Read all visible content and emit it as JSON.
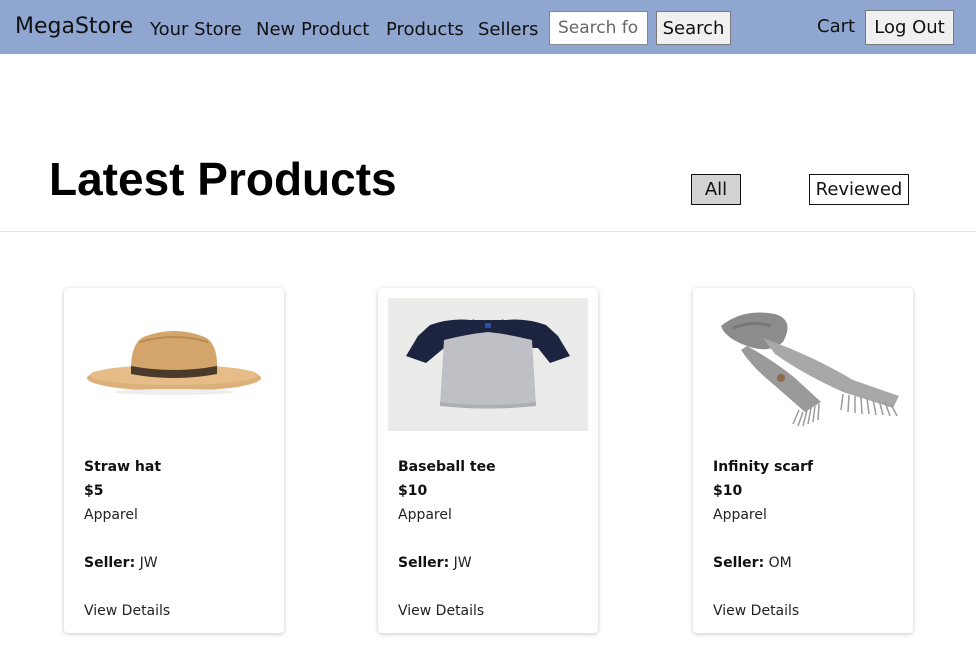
{
  "nav": {
    "brand": "MegaStore",
    "links": [
      "Your Store",
      "New Product",
      "Products",
      "Sellers"
    ],
    "search_placeholder": "Search for",
    "search_button": "Search",
    "cart": "Cart",
    "logout": "Log Out"
  },
  "main": {
    "title": "Latest Products",
    "filters": [
      {
        "label": "All",
        "active": true
      },
      {
        "label": "Reviewed",
        "active": false
      }
    ]
  },
  "products": [
    {
      "name": "Straw hat",
      "price": "$5",
      "category": "Apparel",
      "seller_label": "Seller:",
      "seller": "JW",
      "details": "View Details",
      "image": "straw-hat"
    },
    {
      "name": "Baseball tee",
      "price": "$10",
      "category": "Apparel",
      "seller_label": "Seller:",
      "seller": "JW",
      "details": "View Details",
      "image": "baseball-tee"
    },
    {
      "name": "Infinity scarf",
      "price": "$10",
      "category": "Apparel",
      "seller_label": "Seller:",
      "seller": "OM",
      "details": "View Details",
      "image": "infinity-scarf"
    }
  ],
  "colors": {
    "navbar_bg": "#8fa6d0",
    "active_filter_bg": "#d3d3d3"
  }
}
